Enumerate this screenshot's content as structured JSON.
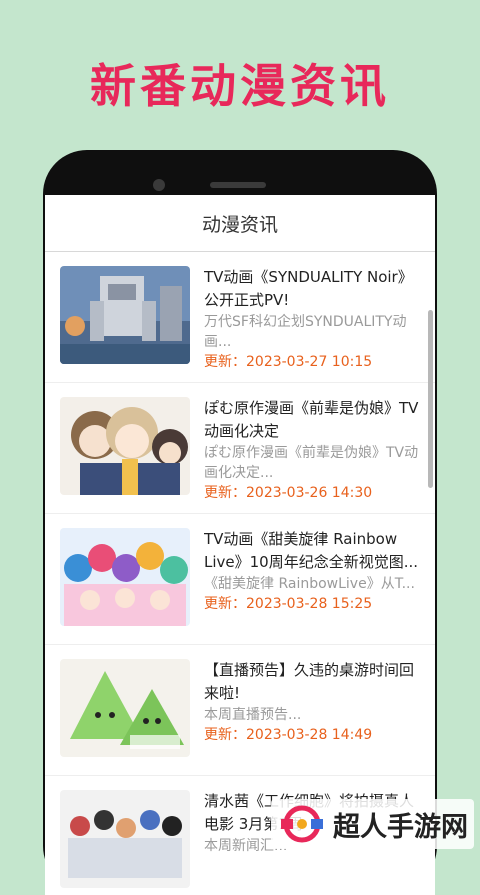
{
  "promo": {
    "title": "新番动漫资讯"
  },
  "app": {
    "header_title": "动漫资讯"
  },
  "news": [
    {
      "title": "TV动画《SYNDUALITY Noir》公开正式PV!",
      "desc": "万代SF科幻企划SYNDUALITY动画...",
      "date": "更新：2023-03-27 10:15"
    },
    {
      "title": "ぽむ原作漫画《前辈是伪娘》TV动画化决定",
      "desc": "ぽむ原作漫画《前辈是伪娘》TV动画化决定...",
      "date": "更新：2023-03-26 14:30"
    },
    {
      "title": "TV动画《甜美旋律 Rainbow Live》10周年纪念全新视觉图...",
      "desc": "《甜美旋律 RainbowLive》从T...",
      "date": "更新：2023-03-28 15:25"
    },
    {
      "title": "【直播预告】久违的桌游时间回来啦!",
      "desc": "本周直播预告...",
      "date": "更新：2023-03-28 14:49"
    },
    {
      "title": "清水茜《工作细胞》将拍摄真人电影 3月第1周",
      "desc": "本周新闻汇...",
      "date": ""
    }
  ],
  "watermark": {
    "text": "超人手游网"
  },
  "colors": {
    "accent": "#e8285a",
    "date": "#e8611d",
    "background": "#c4e6cd"
  }
}
